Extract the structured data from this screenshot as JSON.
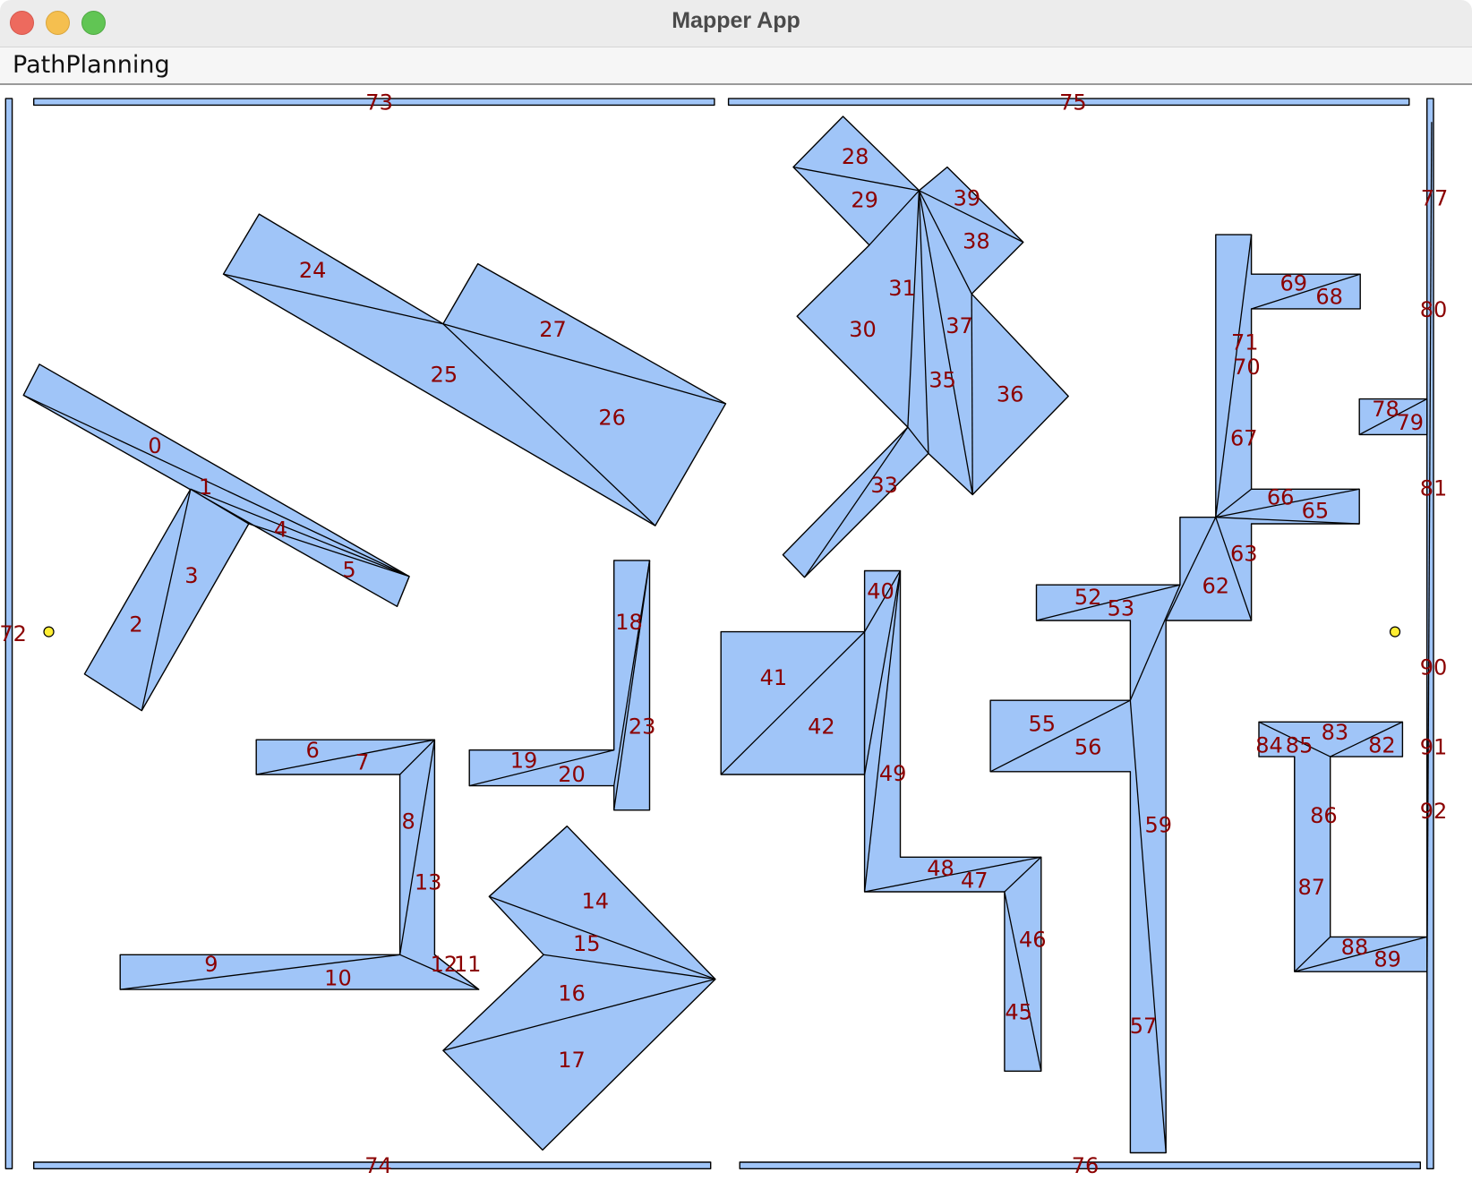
{
  "window": {
    "title": "Mapper App"
  },
  "menu": {
    "items": [
      "PathPlanning"
    ]
  },
  "map": {
    "fill_color": "#a0c5f8",
    "label_color": "#8b0000",
    "marker_color": "#ffee33",
    "region_labels": [
      "0",
      "1",
      "2",
      "3",
      "4",
      "5",
      "6",
      "7",
      "8",
      "9",
      "10",
      "11",
      "12",
      "13",
      "14",
      "15",
      "16",
      "17",
      "18",
      "19",
      "20",
      "23",
      "24",
      "25",
      "26",
      "27",
      "28",
      "29",
      "30",
      "31",
      "33",
      "35",
      "36",
      "37",
      "38",
      "39",
      "40",
      "41",
      "42",
      "45",
      "46",
      "47",
      "48",
      "49",
      "52",
      "53",
      "55",
      "56",
      "57",
      "59",
      "62",
      "63",
      "65",
      "66",
      "67",
      "68",
      "69",
      "70",
      "71",
      "72",
      "73",
      "74",
      "75",
      "76",
      "77",
      "78",
      "79",
      "80",
      "81",
      "82",
      "83",
      "84",
      "85",
      "86",
      "87",
      "88",
      "89",
      "90",
      "91",
      "92"
    ],
    "start_marker": "start-point",
    "goal_marker": "goal-point"
  }
}
